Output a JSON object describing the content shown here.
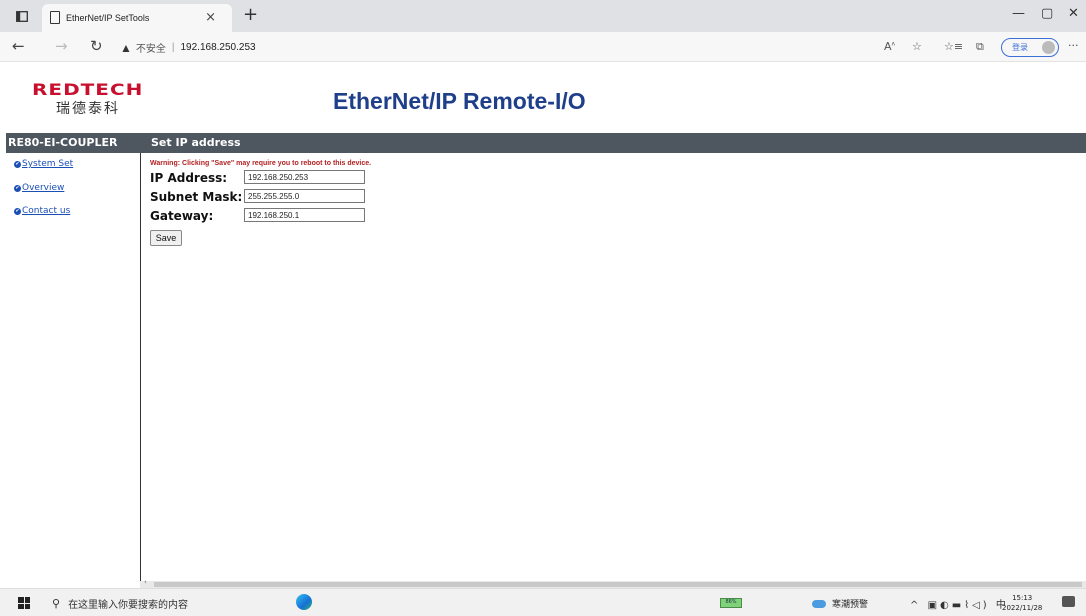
{
  "browser": {
    "tab_title": "EtherNet/IP SetTools",
    "tab_close": "×",
    "new_tab": "+",
    "address_warning": "▲",
    "address_insecure": "不安全",
    "address_separator": "|",
    "url": "192.168.250.253",
    "login_label": "登录",
    "more": "···",
    "window_controls": {
      "minimize": "—",
      "maximize": "▢",
      "close": "✕"
    }
  },
  "header": {
    "logo_en": "REDTECH",
    "logo_cn": "瑞德泰科",
    "title": "EtherNet/IP Remote-I/O"
  },
  "bar": {
    "device_name": "RE80-EI-COUPLER",
    "section_title": "Set IP address"
  },
  "sidebar": {
    "items": [
      {
        "label": "System Set"
      },
      {
        "label": "Overview"
      },
      {
        "label": "Contact us"
      }
    ]
  },
  "form": {
    "warning": "Warning: Clicking \"Save\" may require you to reboot to this device.",
    "fields": [
      {
        "label": "IP Address:",
        "value": "192.168.250.253"
      },
      {
        "label": "Subnet Mask:",
        "value": "255.255.255.0"
      },
      {
        "label": "Gateway:",
        "value": "192.168.250.1"
      }
    ],
    "save_label": "Save"
  },
  "taskbar": {
    "search_placeholder": "在这里输入你要搜索的内容",
    "battery": "86%",
    "weather": "寒潮预警",
    "ime": "中",
    "time": "15:13",
    "date": "2022/11/28"
  },
  "icons": [
    "sidebar-toggle-icon",
    "page-icon",
    "back-arrow-icon",
    "forward-arrow-icon",
    "refresh-icon",
    "warning-icon",
    "read-aloud-icon",
    "favorite-icon",
    "favorites-list-icon",
    "collections-icon",
    "windows-start-icon",
    "search-icon",
    "edge-browser-icon",
    "weather-cloud-icon",
    "notification-icon"
  ]
}
